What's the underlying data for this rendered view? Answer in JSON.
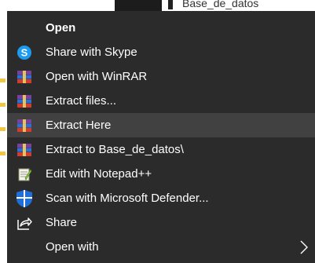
{
  "desktop": {
    "label": "Base_de_datos"
  },
  "menu": {
    "items": [
      {
        "label": "Open",
        "icon": "none",
        "bold": true
      },
      {
        "label": "Share with Skype",
        "icon": "skype-icon"
      },
      {
        "label": "Open with WinRAR",
        "icon": "winrar-icon"
      },
      {
        "label": "Extract files...",
        "icon": "winrar-icon"
      },
      {
        "label": "Extract Here",
        "icon": "winrar-icon",
        "highlighted": true
      },
      {
        "label": "Extract to Base_de_datos\\",
        "icon": "winrar-icon"
      },
      {
        "label": "Edit with Notepad++",
        "icon": "notepad-plus-plus-icon"
      },
      {
        "label": "Scan with Microsoft Defender...",
        "icon": "defender-shield-icon"
      },
      {
        "label": "Share",
        "icon": "share-icon"
      },
      {
        "label": "Open with",
        "icon": "none",
        "submenu": true
      }
    ]
  },
  "colors": {
    "menu_background": "#2b2b2b",
    "highlight": "#414141",
    "text": "#ffffff",
    "skype_blue": "#1d9bf0",
    "defender_blue": "#1e6fd9"
  }
}
